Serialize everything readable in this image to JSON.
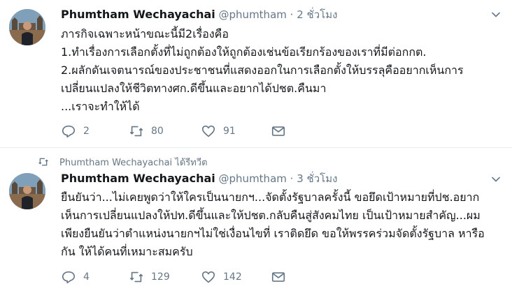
{
  "tweets": [
    {
      "author_name": "Phumtham Wechayachai",
      "handle": "@phumtham",
      "separator": "·",
      "time": "2 ชั่วโมง",
      "text": "ภารกิจเฉพาะหน้าขณะนี้มี2เรื่องคือ\n1.ทำเรื่องการเลือกตั้งที่ไม่ถูกต้องให้ถูกต้องเช่นข้อเรียกร้องของเราที่มีต่อกกต.\n2.ผลักดันเจตนารณ์ของประชาชนที่แสดงออกในการเลือกตั้งให้บรรลุคืออยากเห็นการเปลี่ยนแปลงให้ชีวิตทางศก.ดีขึ้นและอยากได้ปชต.คืนมา\n...เราจะทำให้ได้",
      "replies": "2",
      "retweets": "80",
      "likes": "91"
    },
    {
      "retweet_label": "Phumtham Wechayachai ได้รีทวีต",
      "author_name": "Phumtham Wechayachai",
      "handle": "@phumtham",
      "separator": "·",
      "time": "3 ชั่วโมง",
      "text": "ยืนยันว่า...ไม่เคยพูดว่าให้ใครเป็นนายกฯ...จัดตั้งรัฐบาลครั้งนี้ ขอยึดเป้าหมายที่ปช.อยากเห็นการเปลี่ยนแปลงให้ปท.ดีขึ้นและให้ปชต.กลับคืนสู่สังคมไทย เป็นเป้าหมายสำคัญ...ผมเพียงยืนยันว่าตำแหน่งนายกฯไม่ใช่เงื่อนไขที่ เราติดยึด ขอให้พรรคร่วมจัดตั้งรัฐบาล หารือกัน ให้ได้คนที่เหมาะสมครับ",
      "replies": "4",
      "retweets": "129",
      "likes": "142"
    }
  ],
  "colors": {
    "text": "#14171a",
    "muted": "#657786",
    "divider": "#e6ecf0"
  }
}
